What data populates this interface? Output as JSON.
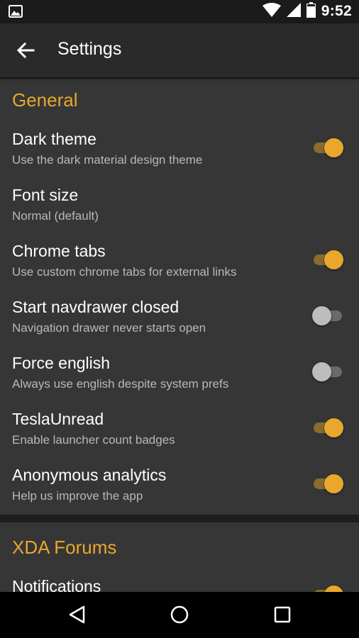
{
  "status_bar": {
    "time": "9:52"
  },
  "app_bar": {
    "title": "Settings"
  },
  "sections": [
    {
      "title": "General",
      "prefs": [
        {
          "title": "Dark theme",
          "summary": "Use the dark material design theme",
          "switch": "on"
        },
        {
          "title": "Font size",
          "summary": "Normal (default)",
          "switch": null
        },
        {
          "title": "Chrome tabs",
          "summary": "Use custom chrome tabs for external links",
          "switch": "on"
        },
        {
          "title": "Start navdrawer closed",
          "summary": "Navigation drawer never starts open",
          "switch": "off"
        },
        {
          "title": "Force english",
          "summary": "Always use english despite system prefs",
          "switch": "off"
        },
        {
          "title": "TeslaUnread",
          "summary": "Enable launcher count badges",
          "switch": "on"
        },
        {
          "title": "Anonymous analytics",
          "summary": "Help us improve the app",
          "switch": "on"
        }
      ]
    },
    {
      "title": "XDA Forums",
      "prefs": [
        {
          "title": "Notifications",
          "summary": "",
          "switch": "on"
        }
      ]
    }
  ],
  "colors": {
    "accent": "#e8a82d",
    "card": "#363636",
    "background": "#1e1e1e",
    "appbar": "#2a2a2a"
  }
}
